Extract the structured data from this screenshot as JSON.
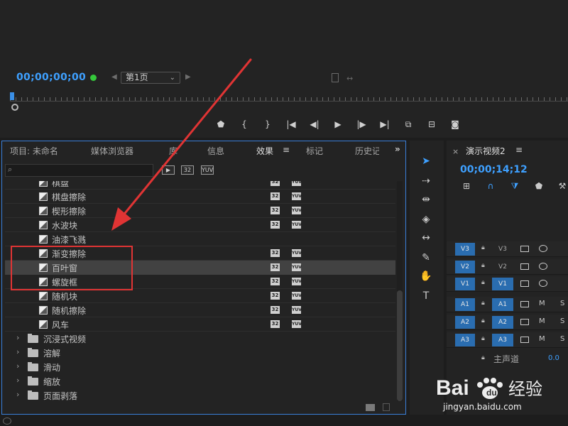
{
  "monitor": {
    "timecode": "00;00;00;00",
    "page_label": "第1页"
  },
  "effects_panel": {
    "tabs": [
      "项目: 未命名",
      "媒体浏览器",
      "库",
      "信息",
      "效果",
      "标记",
      "历史记录"
    ],
    "active_tab": "效果",
    "search_placeholder": "",
    "filter_badges": [
      "32",
      "YUV"
    ],
    "effects": [
      {
        "label": "棋盘",
        "badges": true,
        "partial": true
      },
      {
        "label": "棋盘擦除",
        "badges": true
      },
      {
        "label": "楔形擦除",
        "badges": true
      },
      {
        "label": "水波块",
        "badges": true
      },
      {
        "label": "油漆飞溅",
        "badges": false
      },
      {
        "label": "渐变擦除",
        "badges": true
      },
      {
        "label": "百叶窗",
        "badges": true,
        "selected": true
      },
      {
        "label": "螺旋框",
        "badges": true
      },
      {
        "label": "随机块",
        "badges": true
      },
      {
        "label": "随机擦除",
        "badges": true
      },
      {
        "label": "风车",
        "badges": true
      }
    ],
    "folders": [
      "沉浸式视频",
      "溶解",
      "滑动",
      "缩放",
      "页面剥落"
    ]
  },
  "timeline": {
    "sequence_title": "演示视频2",
    "timecode": "00;00;14;12",
    "video_tracks": [
      {
        "src": "V3",
        "target": "V3",
        "targeted": false
      },
      {
        "src": "V2",
        "target": "V2",
        "targeted": false
      },
      {
        "src": "V1",
        "target": "V1",
        "targeted": true
      }
    ],
    "audio_tracks": [
      {
        "src": "A1",
        "target": "A1"
      },
      {
        "src": "A2",
        "target": "A2"
      },
      {
        "src": "A3",
        "target": "A3"
      }
    ],
    "mute_label": "M",
    "solo_label": "S",
    "master_label": "主声道",
    "master_value": "0.0"
  },
  "watermark": {
    "brand": "Bai",
    "brand_suffix": "经验",
    "url": "jingyan.baidu.com"
  },
  "colors": {
    "accent": "#3ea0ff",
    "highlight": "#e03434",
    "panel_focus": "#3a7fd9"
  }
}
